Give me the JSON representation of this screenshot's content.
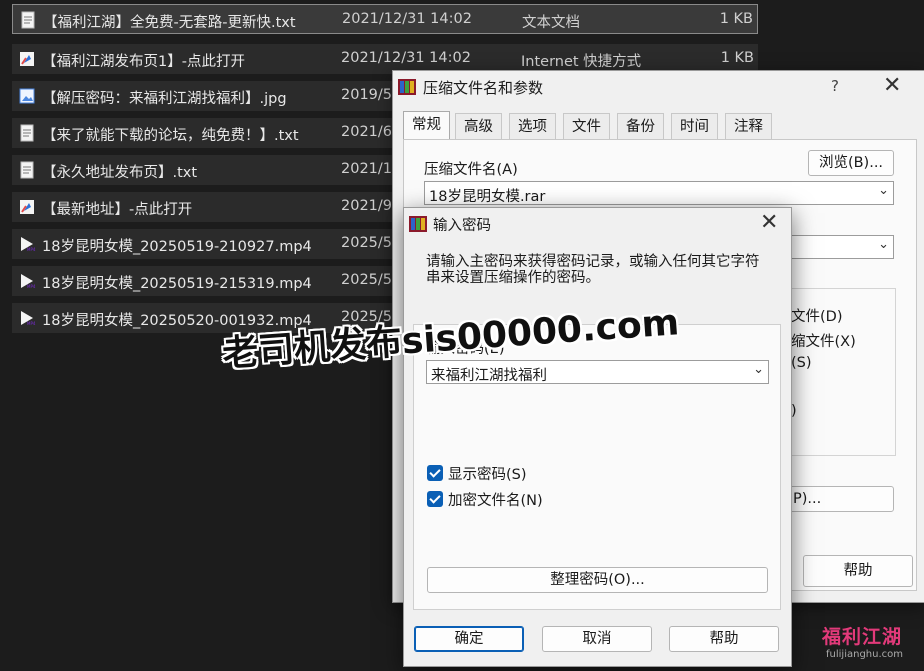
{
  "files": [
    {
      "name": "【福利江湖】全免费-无套路-更新快.txt",
      "date": "2021/12/31 14:02",
      "type": "文本文档",
      "size": "1 KB",
      "icon": "text-file-icon",
      "selected": true
    },
    {
      "name": "【福利江湖发布页1】-点此打开",
      "date": "2021/12/31 14:02",
      "type": "Internet 快捷方式",
      "size": "1 KB",
      "icon": "internet-shortcut-icon",
      "selected": false
    },
    {
      "name": "【解压密码：来福利江湖找福利】.jpg",
      "date": "2019/5",
      "type": "",
      "size": "",
      "icon": "image-file-icon",
      "selected": false
    },
    {
      "name": "【来了就能下载的论坛，纯免费！】.txt",
      "date": "2021/6",
      "type": "",
      "size": "",
      "icon": "text-file-icon",
      "selected": false
    },
    {
      "name": "【永久地址发布页】.txt",
      "date": "2021/1",
      "type": "",
      "size": "",
      "icon": "text-file-icon",
      "selected": false
    },
    {
      "name": "【最新地址】-点此打开",
      "date": "2021/9",
      "type": "",
      "size": "",
      "icon": "internet-shortcut-icon",
      "selected": false
    },
    {
      "name": "18岁昆明女模_20250519-210927.mp4",
      "date": "2025/5",
      "type": "",
      "size": "",
      "icon": "video-file-icon",
      "selected": false
    },
    {
      "name": "18岁昆明女模_20250519-215319.mp4",
      "date": "2025/5",
      "type": "",
      "size": "",
      "icon": "video-file-icon",
      "selected": false
    },
    {
      "name": "18岁昆明女模_20250520-001932.mp4",
      "date": "2025/5",
      "type": "",
      "size": "",
      "icon": "video-file-icon",
      "selected": false
    }
  ],
  "archive_dialog": {
    "title": "压缩文件名和参数",
    "help": "?",
    "close": "✕",
    "tabs": [
      "常规",
      "高级",
      "选项",
      "文件",
      "备份",
      "时间",
      "注释"
    ],
    "active_tab": 0,
    "archive_name_label": "压缩文件名(A)",
    "browse_button": "浏览(B)...",
    "archive_name_value": "18岁昆明女模.rar",
    "option_fragments": [
      "文件(D)",
      "缩文件(X)",
      "(S)",
      ")"
    ],
    "set_password_fragment": "P)...",
    "help_button": "帮助"
  },
  "password_dialog": {
    "title": "输入密码",
    "close": "✕",
    "description": "请输入主密码来获得密码记录，或输入任何其它字符串来设置压缩操作的密码。",
    "password_label": "输入密码(E)",
    "password_value": "来福利江湖找福利",
    "show_password_label": "显示密码(S)",
    "show_password_checked": true,
    "encrypt_names_label": "加密文件名(N)",
    "encrypt_names_checked": true,
    "organize_button": "整理密码(O)...",
    "ok_button": "确定",
    "cancel_button": "取消",
    "help_button": "帮助"
  },
  "watermarks": {
    "overlay_text": "老司机发布sis00000.com",
    "logo_text": "福利江湖",
    "logo_url_text": "fulijianghu.com"
  }
}
